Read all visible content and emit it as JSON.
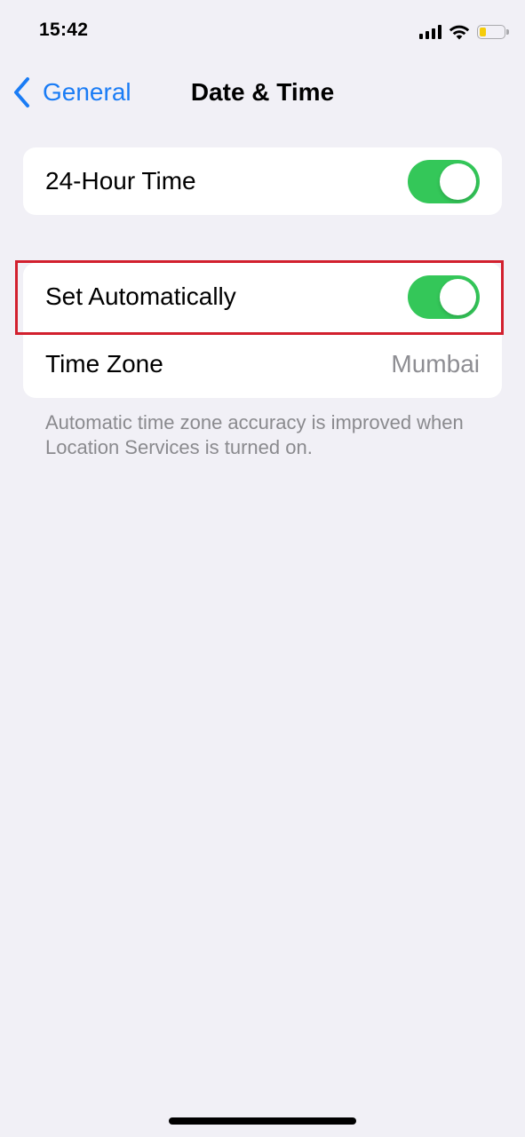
{
  "status_bar": {
    "time": "15:42",
    "icons": [
      "signal-icon",
      "wifi-icon",
      "battery-icon"
    ],
    "battery_level_pct": 25,
    "battery_color": "#f5cc0a"
  },
  "nav": {
    "back_label": "General",
    "title": "Date & Time",
    "accent_color": "#1a7cf5"
  },
  "settings": {
    "hour24": {
      "label": "24-Hour Time",
      "enabled": true
    },
    "set_automatically": {
      "label": "Set Automatically",
      "enabled": true,
      "highlighted": true
    },
    "time_zone": {
      "label": "Time Zone",
      "value": "Mumbai"
    },
    "footer": "Automatic time zone accuracy is improved when Location Services is turned on."
  },
  "colors": {
    "toggle_on": "#34c759",
    "highlight": "#d2202e",
    "background": "#f1f0f6"
  }
}
